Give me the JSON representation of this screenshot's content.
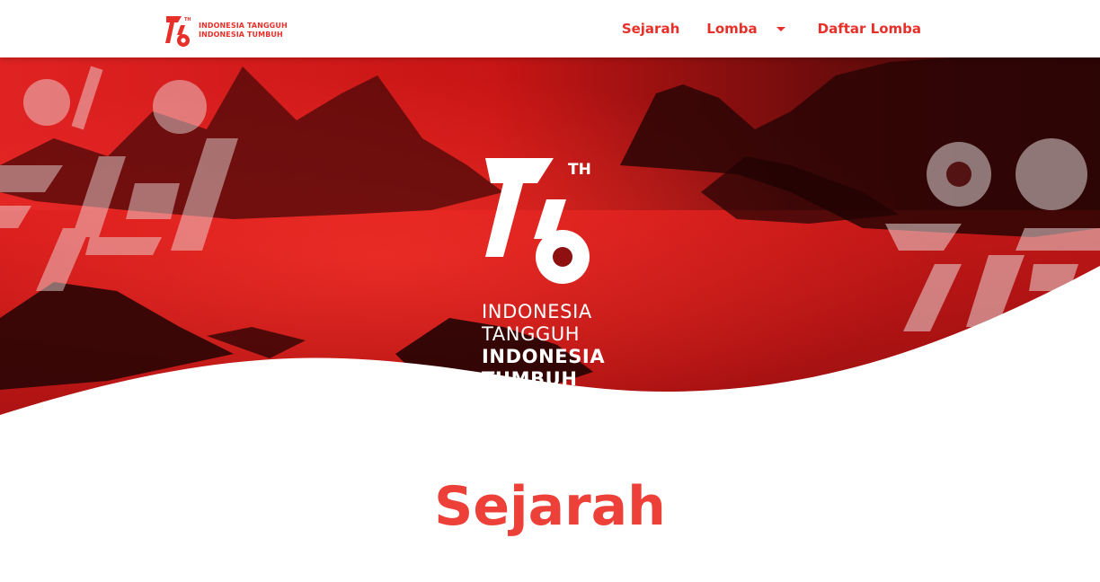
{
  "brand": {
    "number": "76",
    "superscript": "TH",
    "line1": "INDONESIA TANGGUH",
    "line2": "INDONESIA TUMBUH"
  },
  "nav": {
    "items": [
      {
        "label": "Sejarah"
      },
      {
        "label": "Lomba"
      },
      {
        "label": "Daftar Lomba"
      }
    ]
  },
  "hero": {
    "number": "76",
    "superscript": "TH",
    "line1": "INDONESIA",
    "line2": "TANGGUH",
    "line3": "INDONESIA",
    "line4": "TUMBUH"
  },
  "section": {
    "title": "Sejarah"
  },
  "colors": {
    "accent": "#e8302a",
    "title": "#ec4039",
    "hero_red": "#d41c1c",
    "hero_dark": "#3a0707"
  },
  "icons": [
    "caret-down-icon"
  ]
}
